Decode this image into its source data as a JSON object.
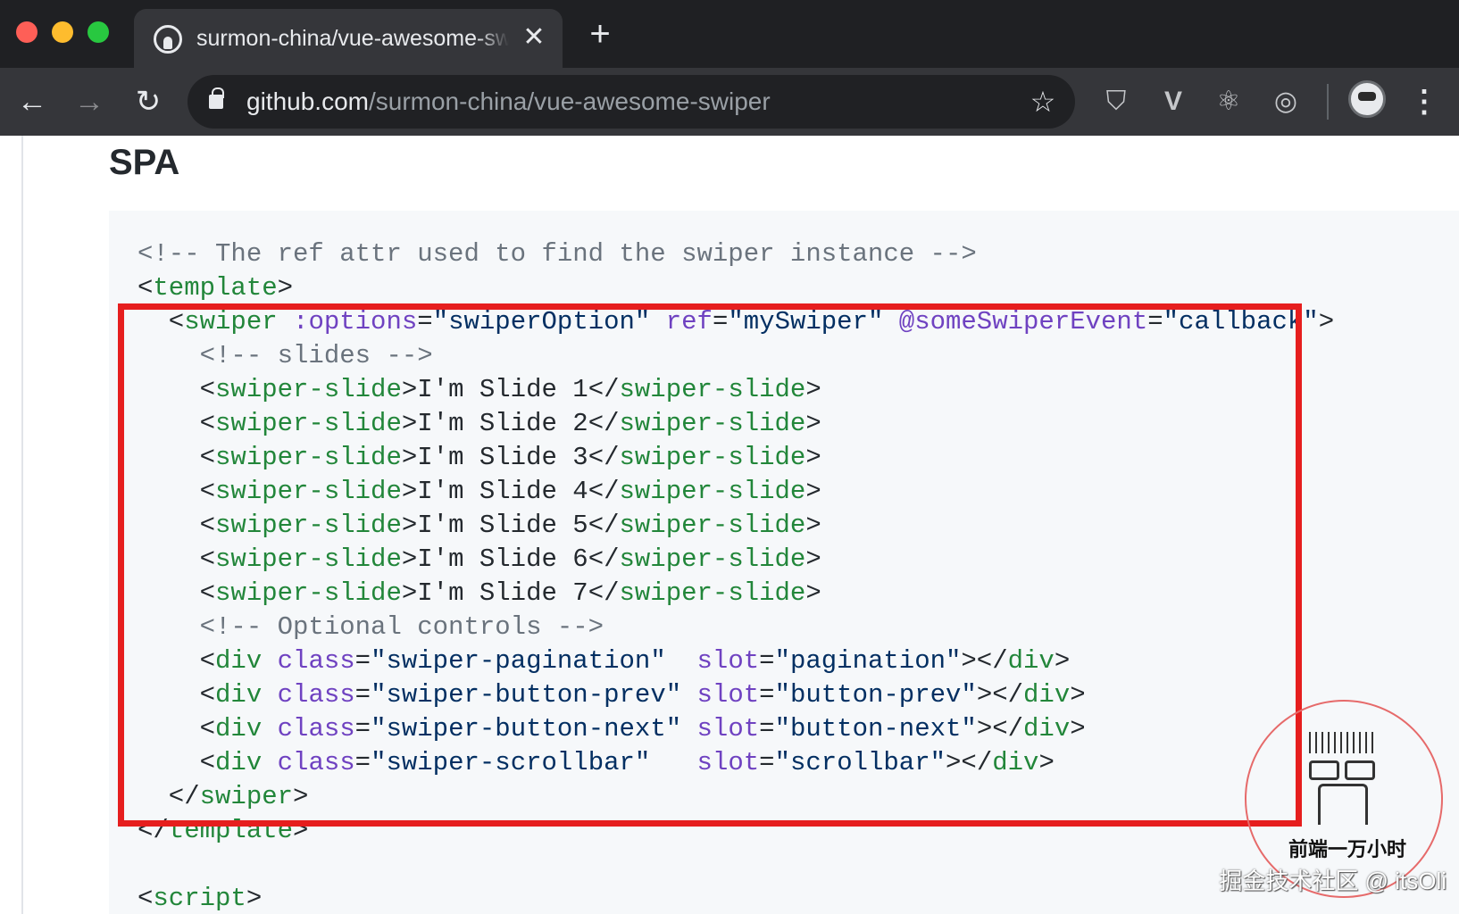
{
  "browser": {
    "tab": {
      "title": "surmon-china/vue-awesome-swiper",
      "close_glyph": "✕",
      "favicon": "github-icon"
    },
    "new_tab_glyph": "+",
    "nav": {
      "back_glyph": "←",
      "forward_glyph": "→",
      "reload_glyph": "↻"
    },
    "address": {
      "host": "github.com",
      "path": "/surmon-china/vue-awesome-swiper",
      "lock_icon": "lock-icon",
      "bookmark_glyph": "☆"
    },
    "extensions": [
      {
        "name": "shield-extension-icon",
        "glyph": "⛉"
      },
      {
        "name": "vue-devtools-icon",
        "glyph": "V"
      },
      {
        "name": "react-devtools-icon",
        "glyph": "⚛"
      },
      {
        "name": "target-extension-icon",
        "glyph": "◎"
      }
    ],
    "menu_glyph": "⋮"
  },
  "page": {
    "heading": "SPA",
    "code_lines": [
      [
        {
          "t": "<!-- The ref attr used to find the swiper instance -->",
          "c": "cm"
        }
      ],
      [
        {
          "t": "<"
        },
        {
          "t": "template",
          "c": "tag"
        },
        {
          "t": ">"
        }
      ],
      [
        {
          "t": "  <"
        },
        {
          "t": "swiper",
          "c": "tag"
        },
        {
          "t": " "
        },
        {
          "t": ":options",
          "c": "attr"
        },
        {
          "t": "="
        },
        {
          "t": "\"swiperOption\"",
          "c": "str"
        },
        {
          "t": " "
        },
        {
          "t": "ref",
          "c": "attr"
        },
        {
          "t": "="
        },
        {
          "t": "\"mySwiper\"",
          "c": "str"
        },
        {
          "t": " "
        },
        {
          "t": "@someSwiperEvent",
          "c": "attr"
        },
        {
          "t": "="
        },
        {
          "t": "\"callback\"",
          "c": "str"
        },
        {
          "t": ">"
        }
      ],
      [
        {
          "t": "    <!-- slides -->",
          "c": "cm"
        }
      ],
      [
        {
          "t": "    <"
        },
        {
          "t": "swiper-slide",
          "c": "tag"
        },
        {
          "t": ">I'm Slide 1</"
        },
        {
          "t": "swiper-slide",
          "c": "tag"
        },
        {
          "t": ">"
        }
      ],
      [
        {
          "t": "    <"
        },
        {
          "t": "swiper-slide",
          "c": "tag"
        },
        {
          "t": ">I'm Slide 2</"
        },
        {
          "t": "swiper-slide",
          "c": "tag"
        },
        {
          "t": ">"
        }
      ],
      [
        {
          "t": "    <"
        },
        {
          "t": "swiper-slide",
          "c": "tag"
        },
        {
          "t": ">I'm Slide 3</"
        },
        {
          "t": "swiper-slide",
          "c": "tag"
        },
        {
          "t": ">"
        }
      ],
      [
        {
          "t": "    <"
        },
        {
          "t": "swiper-slide",
          "c": "tag"
        },
        {
          "t": ">I'm Slide 4</"
        },
        {
          "t": "swiper-slide",
          "c": "tag"
        },
        {
          "t": ">"
        }
      ],
      [
        {
          "t": "    <"
        },
        {
          "t": "swiper-slide",
          "c": "tag"
        },
        {
          "t": ">I'm Slide 5</"
        },
        {
          "t": "swiper-slide",
          "c": "tag"
        },
        {
          "t": ">"
        }
      ],
      [
        {
          "t": "    <"
        },
        {
          "t": "swiper-slide",
          "c": "tag"
        },
        {
          "t": ">I'm Slide 6</"
        },
        {
          "t": "swiper-slide",
          "c": "tag"
        },
        {
          "t": ">"
        }
      ],
      [
        {
          "t": "    <"
        },
        {
          "t": "swiper-slide",
          "c": "tag"
        },
        {
          "t": ">I'm Slide 7</"
        },
        {
          "t": "swiper-slide",
          "c": "tag"
        },
        {
          "t": ">"
        }
      ],
      [
        {
          "t": "    <!-- Optional controls -->",
          "c": "cm"
        }
      ],
      [
        {
          "t": "    <"
        },
        {
          "t": "div",
          "c": "tag"
        },
        {
          "t": " "
        },
        {
          "t": "class",
          "c": "attr"
        },
        {
          "t": "="
        },
        {
          "t": "\"swiper-pagination\"",
          "c": "str"
        },
        {
          "t": "  "
        },
        {
          "t": "slot",
          "c": "attr"
        },
        {
          "t": "="
        },
        {
          "t": "\"pagination\"",
          "c": "str"
        },
        {
          "t": "></"
        },
        {
          "t": "div",
          "c": "tag"
        },
        {
          "t": ">"
        }
      ],
      [
        {
          "t": "    <"
        },
        {
          "t": "div",
          "c": "tag"
        },
        {
          "t": " "
        },
        {
          "t": "class",
          "c": "attr"
        },
        {
          "t": "="
        },
        {
          "t": "\"swiper-button-prev\"",
          "c": "str"
        },
        {
          "t": " "
        },
        {
          "t": "slot",
          "c": "attr"
        },
        {
          "t": "="
        },
        {
          "t": "\"button-prev\"",
          "c": "str"
        },
        {
          "t": "></"
        },
        {
          "t": "div",
          "c": "tag"
        },
        {
          "t": ">"
        }
      ],
      [
        {
          "t": "    <"
        },
        {
          "t": "div",
          "c": "tag"
        },
        {
          "t": " "
        },
        {
          "t": "class",
          "c": "attr"
        },
        {
          "t": "="
        },
        {
          "t": "\"swiper-button-next\"",
          "c": "str"
        },
        {
          "t": " "
        },
        {
          "t": "slot",
          "c": "attr"
        },
        {
          "t": "="
        },
        {
          "t": "\"button-next\"",
          "c": "str"
        },
        {
          "t": "></"
        },
        {
          "t": "div",
          "c": "tag"
        },
        {
          "t": ">"
        }
      ],
      [
        {
          "t": "    <"
        },
        {
          "t": "div",
          "c": "tag"
        },
        {
          "t": " "
        },
        {
          "t": "class",
          "c": "attr"
        },
        {
          "t": "="
        },
        {
          "t": "\"swiper-scrollbar\"",
          "c": "str"
        },
        {
          "t": "   "
        },
        {
          "t": "slot",
          "c": "attr"
        },
        {
          "t": "="
        },
        {
          "t": "\"scrollbar\"",
          "c": "str"
        },
        {
          "t": "></"
        },
        {
          "t": "div",
          "c": "tag"
        },
        {
          "t": ">"
        }
      ],
      [
        {
          "t": "  </"
        },
        {
          "t": "swiper",
          "c": "tag"
        },
        {
          "t": ">"
        }
      ],
      [
        {
          "t": "</"
        },
        {
          "t": "template",
          "c": "tag"
        },
        {
          "t": ">"
        }
      ],
      [
        {
          "t": ""
        }
      ],
      [
        {
          "t": "<"
        },
        {
          "t": "script",
          "c": "tag"
        },
        {
          "t": ">"
        }
      ]
    ]
  },
  "watermark": {
    "title": "前端一万小时",
    "credit": "掘金技术社区 @ itsOli"
  },
  "colors": {
    "highlight_border": "#e61e1e",
    "code_background": "#f6f8fa",
    "tag": "#22863a",
    "attr": "#6f42c1",
    "string": "#032f62",
    "comment": "#6a737d"
  }
}
